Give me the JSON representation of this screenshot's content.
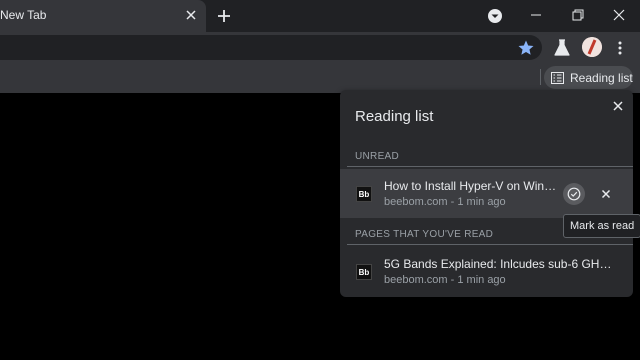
{
  "tab": {
    "title": "New Tab"
  },
  "toolbar": {
    "avatar_letter": "/"
  },
  "reading_list_button": {
    "label": "Reading list"
  },
  "panel": {
    "title": "Reading list",
    "sections": {
      "unread": "UNREAD",
      "read": "PAGES THAT YOU'VE READ"
    },
    "unread_items": [
      {
        "favicon": "Bb",
        "title": "How to Install Hyper-V on Wind…",
        "meta": "beebom.com - 1 min ago"
      }
    ],
    "read_items": [
      {
        "favicon": "Bb",
        "title": "5G Bands Explained: Inlcudes sub-6 GHz …",
        "meta": "beebom.com - 1 min ago"
      }
    ]
  },
  "tooltip": {
    "text": "Mark as read"
  },
  "colors": {
    "accent_star": "#8ab4f8",
    "panel_bg": "#292a2d",
    "hover_row": "#3c3d41"
  }
}
